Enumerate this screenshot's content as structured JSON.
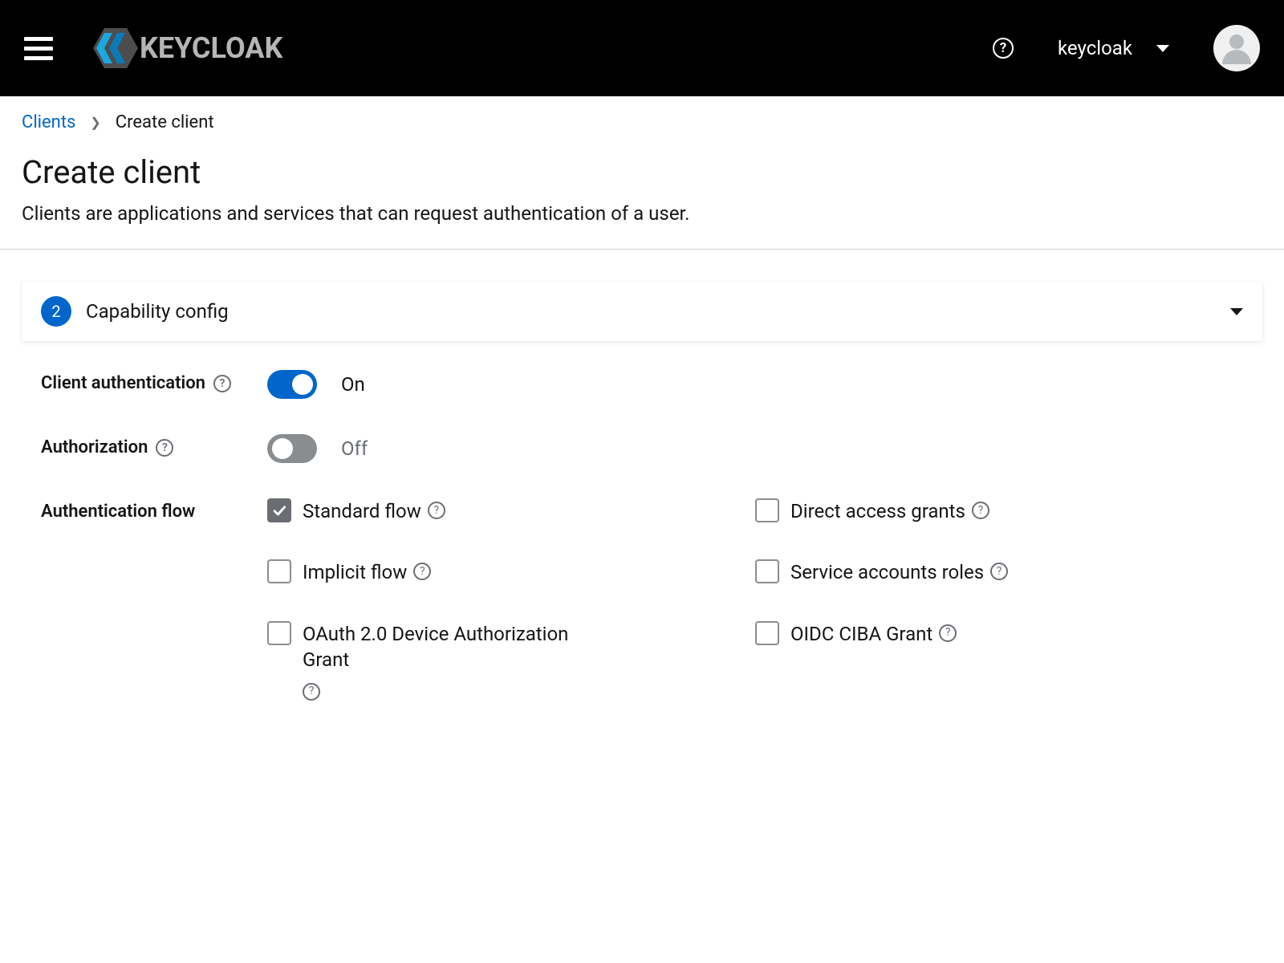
{
  "header": {
    "logo_text": "KEYCLOAK",
    "realm": "keycloak"
  },
  "breadcrumb": {
    "parent": "Clients",
    "current": "Create client"
  },
  "page": {
    "title": "Create client",
    "subtitle": "Clients are applications and services that can request authentication of a user."
  },
  "wizard": {
    "step_number": "2",
    "step_title": "Capability config"
  },
  "form": {
    "client_auth": {
      "label": "Client authentication",
      "value": "On",
      "on": true
    },
    "authorization": {
      "label": "Authorization",
      "value": "Off",
      "on": false
    },
    "auth_flow": {
      "label": "Authentication flow",
      "items": [
        {
          "label": "Standard flow",
          "checked": true,
          "help": true
        },
        {
          "label": "Direct access grants",
          "checked": false,
          "help": true
        },
        {
          "label": "Implicit flow",
          "checked": false,
          "help": true
        },
        {
          "label": "Service accounts roles",
          "checked": false,
          "help": true
        },
        {
          "label": "OAuth 2.0 Device Authorization Grant",
          "checked": false,
          "help": true
        },
        {
          "label": "OIDC CIBA Grant",
          "checked": false,
          "help": true
        }
      ]
    }
  }
}
